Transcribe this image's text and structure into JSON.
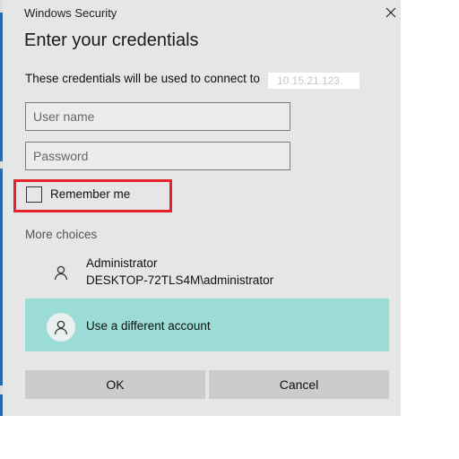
{
  "window": {
    "title": "Windows Security",
    "close_icon": "close-icon"
  },
  "dialog": {
    "heading": "Enter your credentials",
    "description": "These credentials will be used to connect to",
    "redacted_host": "10.15.21.123."
  },
  "form": {
    "username_placeholder": "User name",
    "username_value": "",
    "password_placeholder": "Password",
    "password_value": "",
    "remember_label": "Remember me",
    "remember_checked": false
  },
  "choices": {
    "label": "More choices",
    "accounts": [
      {
        "name": "Administrator",
        "detail": "DESKTOP-72TLS4M\\administrator",
        "icon": "user-icon"
      },
      {
        "name": "Use a different account",
        "icon": "user-icon",
        "selected": true
      }
    ]
  },
  "buttons": {
    "ok_label": "OK",
    "cancel_label": "Cancel"
  },
  "colors": {
    "dialog_bg": "#e6e6e6",
    "selected_account_bg": "#9bdcd6",
    "highlight_box": "#e8222c",
    "button_bg": "#cccccc"
  }
}
